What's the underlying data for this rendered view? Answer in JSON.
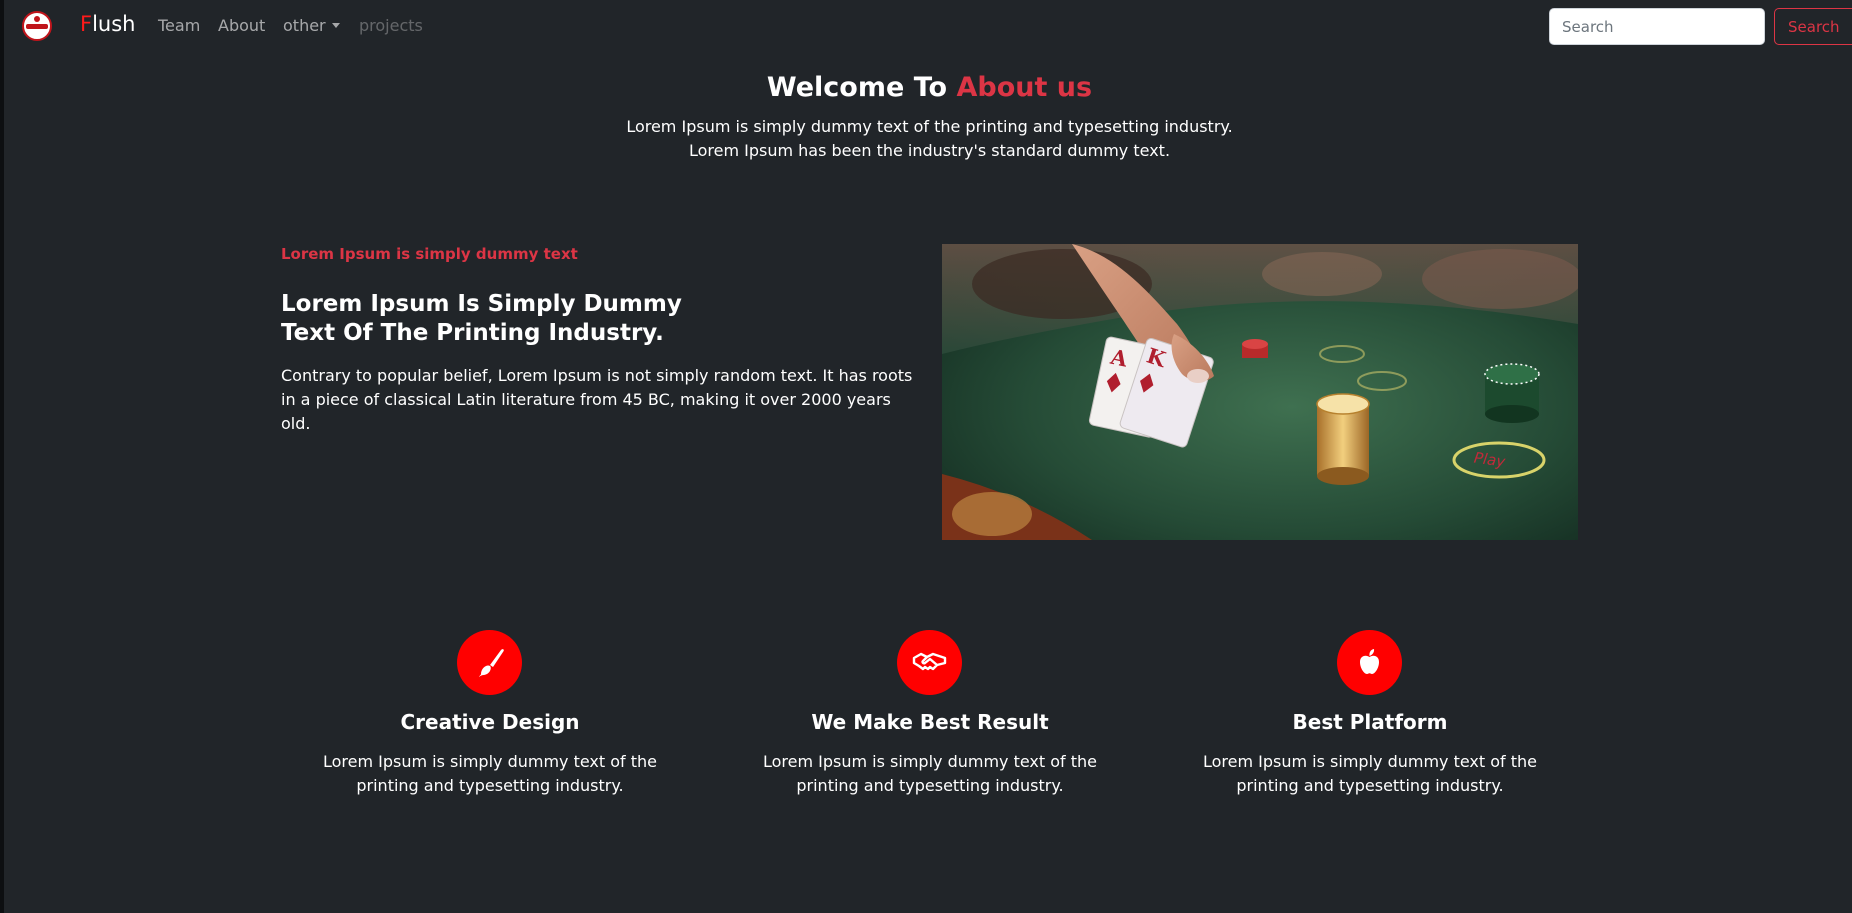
{
  "nav": {
    "brand_first": "F",
    "brand_rest": "lush",
    "links": [
      {
        "label": "Team"
      },
      {
        "label": "About"
      },
      {
        "label": "other"
      },
      {
        "label": "projects"
      }
    ],
    "search": {
      "placeholder": "Search",
      "button_label": "Search"
    }
  },
  "hero": {
    "title_prefix": "Welcome To",
    "title_accent": "About us",
    "lines": [
      "Lorem Ipsum is simply dummy text of the printing and typesetting industry.",
      "Lorem Ipsum has been the industry's standard dummy text."
    ]
  },
  "about": {
    "kicker": "Lorem Ipsum is simply dummy text",
    "heading_lines": [
      "Lorem Ipsum Is Simply Dummy",
      "Text Of The Printing Industry."
    ],
    "body_lines": [
      "Contrary to popular belief, Lorem Ipsum is not simply random text. It has roots",
      "in a piece of classical Latin literature from 45 BC, making it over 2000 years old."
    ],
    "image_label": "Play"
  },
  "features": [
    {
      "icon": "brush-icon",
      "title": "Creative Design",
      "lines": [
        "Lorem Ipsum is simply dummy text of the",
        "printing and typesetting industry."
      ]
    },
    {
      "icon": "handshake-icon",
      "title": "We Make Best Result",
      "lines": [
        "Lorem Ipsum is simply dummy text of the",
        "printing and typesetting industry."
      ]
    },
    {
      "icon": "apple-icon",
      "title": "Best Platform",
      "lines": [
        "Lorem Ipsum is simply dummy text of the",
        "printing and typesetting industry."
      ]
    }
  ],
  "colors": {
    "background": "#212529",
    "accent": "#dc3545",
    "brand_red": "#ff1a1a",
    "icon_circle": "#ff0000"
  }
}
